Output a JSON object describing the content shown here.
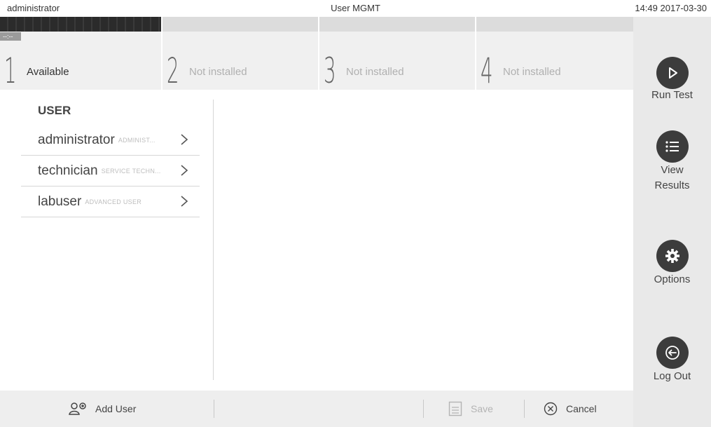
{
  "topbar": {
    "user": "administrator",
    "title": "User MGMT",
    "clock": "14:49 2017-03-30"
  },
  "modules": [
    {
      "number": "1",
      "status": "Available",
      "badge": "--:--",
      "active": true
    },
    {
      "number": "2",
      "status": "Not installed",
      "active": false
    },
    {
      "number": "3",
      "status": "Not installed",
      "active": false
    },
    {
      "number": "4",
      "status": "Not installed",
      "active": false
    }
  ],
  "sidebar": {
    "run_test": "Run Test",
    "view_results_line1": "View",
    "view_results_line2": "Results",
    "options": "Options",
    "log_out": "Log Out"
  },
  "user_panel": {
    "title": "USER",
    "users": [
      {
        "name": "administrator",
        "role": "ADMINIST..."
      },
      {
        "name": "technician",
        "role": "SERVICE TECHN..."
      },
      {
        "name": "labuser",
        "role": "ADVANCED USER"
      }
    ]
  },
  "toolbar": {
    "add_user": "Add User",
    "save": "Save",
    "cancel": "Cancel"
  },
  "icons": {
    "run_test": "play-icon",
    "view_results": "list-icon",
    "options": "gear-icon",
    "log_out": "logout-arrow-icon",
    "add_user": "add-user-icon",
    "save": "save-icon",
    "cancel": "cancel-x-icon",
    "row": "chevron-right-icon"
  },
  "colors": {
    "sidebar_bg": "#e9e9e9",
    "button_circle": "#3c3c3c",
    "active_strip": "#2b2b2b",
    "inactive_strip": "#dcdcdc"
  }
}
